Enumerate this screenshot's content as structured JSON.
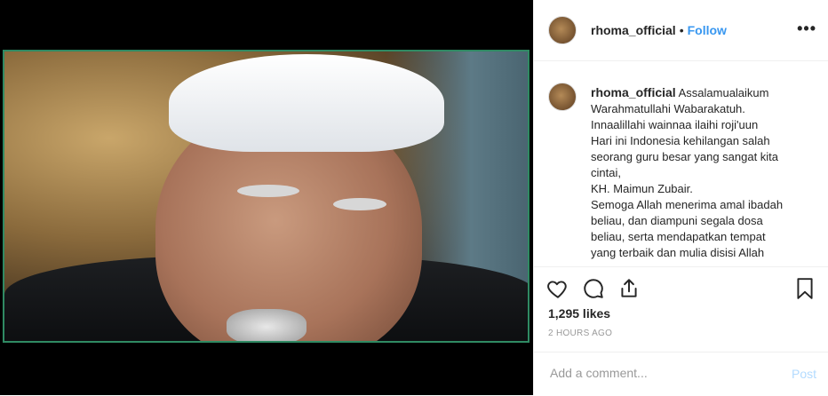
{
  "post": {
    "username": "rhoma_official",
    "separator": "•",
    "follow_label": "Follow",
    "more_label": "•••",
    "caption_lines": [
      "Assalamualaikum",
      "Warahmatullahi Wabarakatuh.",
      "Innaalillahi wainnaa ilaihi roji'uun",
      "Hari ini Indonesia kehilangan salah",
      "seorang guru besar yang sangat kita",
      "cintai,",
      "KH. Maimun Zubair.",
      "Semoga Allah menerima amal ibadah",
      "beliau, dan diampuni segala dosa",
      "beliau, serta mendapatkan tempat",
      "yang terbaik dan mulia disisi Allah"
    ],
    "likes": "1,295 likes",
    "time": "2 HOURS AGO",
    "comment_placeholder": "Add a comment...",
    "post_label": "Post"
  },
  "icons": {
    "like": "heart-icon",
    "comment": "comment-icon",
    "share": "share-icon",
    "save": "bookmark-icon"
  },
  "colors": {
    "follow": "#3897f0",
    "post_disabled": "#b3dbff",
    "photo_border": "#2f8a63"
  }
}
